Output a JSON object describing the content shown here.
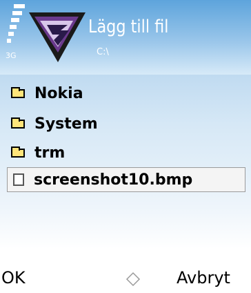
{
  "status": {
    "network": "3G"
  },
  "header": {
    "title": "Lägg till fil",
    "path": "C:\\"
  },
  "list": {
    "folders": [
      {
        "label": "Nokia",
        "icon": "folder-icon"
      },
      {
        "label": "System",
        "icon": "folder-icon"
      },
      {
        "label": "trm",
        "icon": "folder-icon"
      }
    ],
    "selected_file": {
      "label": "screenshot10.bmp",
      "icon": "file-icon"
    }
  },
  "softkeys": {
    "left": "OK",
    "right": "Avbryt"
  },
  "colors": {
    "header_top": "#5da4dc",
    "folder": "#ffe57a"
  }
}
